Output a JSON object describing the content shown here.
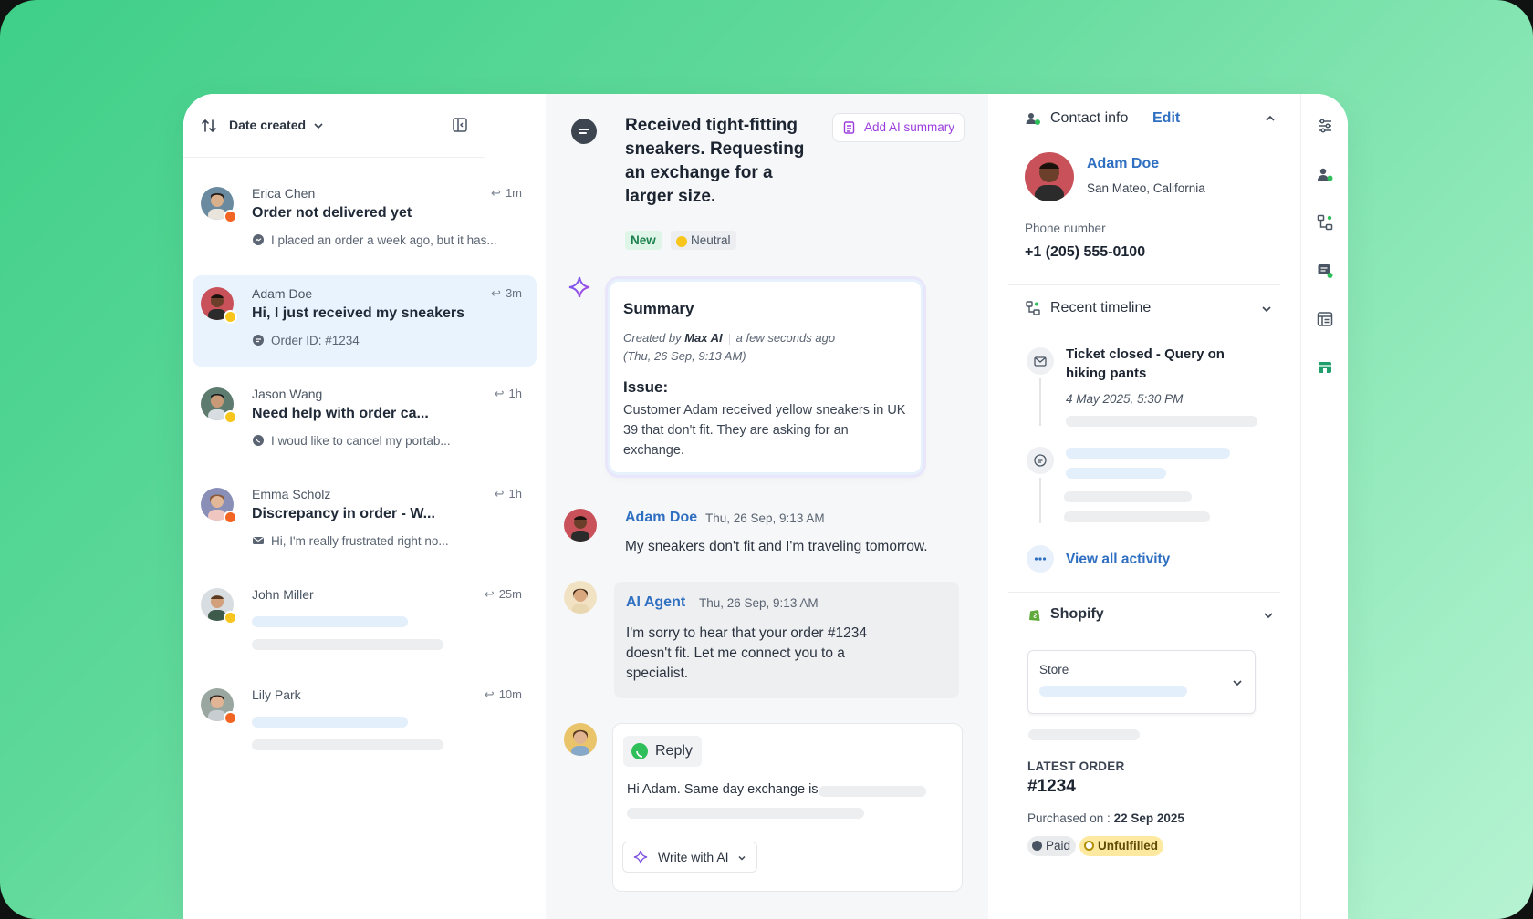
{
  "list": {
    "sort_label": "Date created",
    "conversations": [
      {
        "name": "Erica Chen",
        "time": "1m",
        "subject": "Order not delivered yet",
        "preview": "I placed an order a week ago, but it has...",
        "channel": "messenger-icon",
        "mood_color": "#f26522"
      },
      {
        "name": "Adam Doe",
        "time": "3m",
        "subject": "Hi, I just received my sneakers",
        "preview": "Order ID: #1234",
        "channel": "chat-icon",
        "mood_color": "#f7c51b"
      },
      {
        "name": "Jason Wang",
        "time": "1h",
        "subject": "Need help with order ca...",
        "preview": "I woud like to cancel my portab...",
        "channel": "whatsapp-icon",
        "mood_color": "#f7c51b"
      },
      {
        "name": "Emma Scholz",
        "time": "1h",
        "subject": "Discrepancy in order - W...",
        "preview": "Hi, I'm really frustrated right no...",
        "channel": "email-icon",
        "mood_color": "#f26522"
      },
      {
        "name": "John Miller",
        "time": "25m",
        "mood_color": "#f7c51b"
      },
      {
        "name": "Lily Park",
        "time": "10m",
        "mood_color": "#f26522"
      }
    ]
  },
  "ticket": {
    "title": "Received tight-fitting sneakers. Requesting an exchange for a larger size.",
    "ai_summary_button": "Add AI summary",
    "status_tag": "New",
    "sentiment_tag": "Neutral"
  },
  "summary": {
    "title": "Summary",
    "created_prefix": "Created by",
    "created_by": "Max AI",
    "created_when": "a few seconds ago",
    "created_date": "(Thu, 26 Sep, 9:13 AM)",
    "issue_heading": "Issue:",
    "issue_text": "Customer Adam received yellow sneakers in UK 39 that don't fit. They are asking for an exchange."
  },
  "messages": [
    {
      "name": "Adam Doe",
      "time": "Thu, 26 Sep, 9:13 AM",
      "text": "My sneakers don't fit and I'm traveling tomorrow."
    },
    {
      "name": "AI Agent",
      "time": "Thu, 26 Sep, 9:13 AM",
      "text": "I'm sorry to hear that your order #1234 doesn't fit. Let me connect you to a specialist."
    }
  ],
  "reply": {
    "tab_label": "Reply",
    "draft_text": "Hi Adam. Same day exchange is",
    "write_ai_label": "Write with AI"
  },
  "contact": {
    "section_title": "Contact info",
    "edit_label": "Edit",
    "name": "Adam Doe",
    "location": "San Mateo, California",
    "phone_label": "Phone number",
    "phone": "+1 (205) 555-0100"
  },
  "timeline": {
    "section_title": "Recent timeline",
    "item_title": "Ticket closed - Query on hiking pants",
    "item_date": "4 May 2025, 5:30 PM",
    "view_all": "View all activity"
  },
  "shopify": {
    "section_title": "Shopify",
    "store_label": "Store",
    "latest_order_label": "LATEST ORDER",
    "order_number": "#1234",
    "purchased_label": "Purchased on :",
    "purchased_date": "22 Sep 2025",
    "payment_status": "Paid",
    "fulfillment_status": "Unfulfilled"
  },
  "colors": {
    "accent_blue": "#2f6fc1",
    "ai_purple": "#9b3ddd",
    "new_green": "#1a7f4b",
    "unfulfilled_yellow": "#fdeaa0"
  },
  "rail_icons": [
    "sliders-icon",
    "contact-icon",
    "workflow-icon",
    "ticket-icon",
    "table-icon",
    "store-icon"
  ]
}
